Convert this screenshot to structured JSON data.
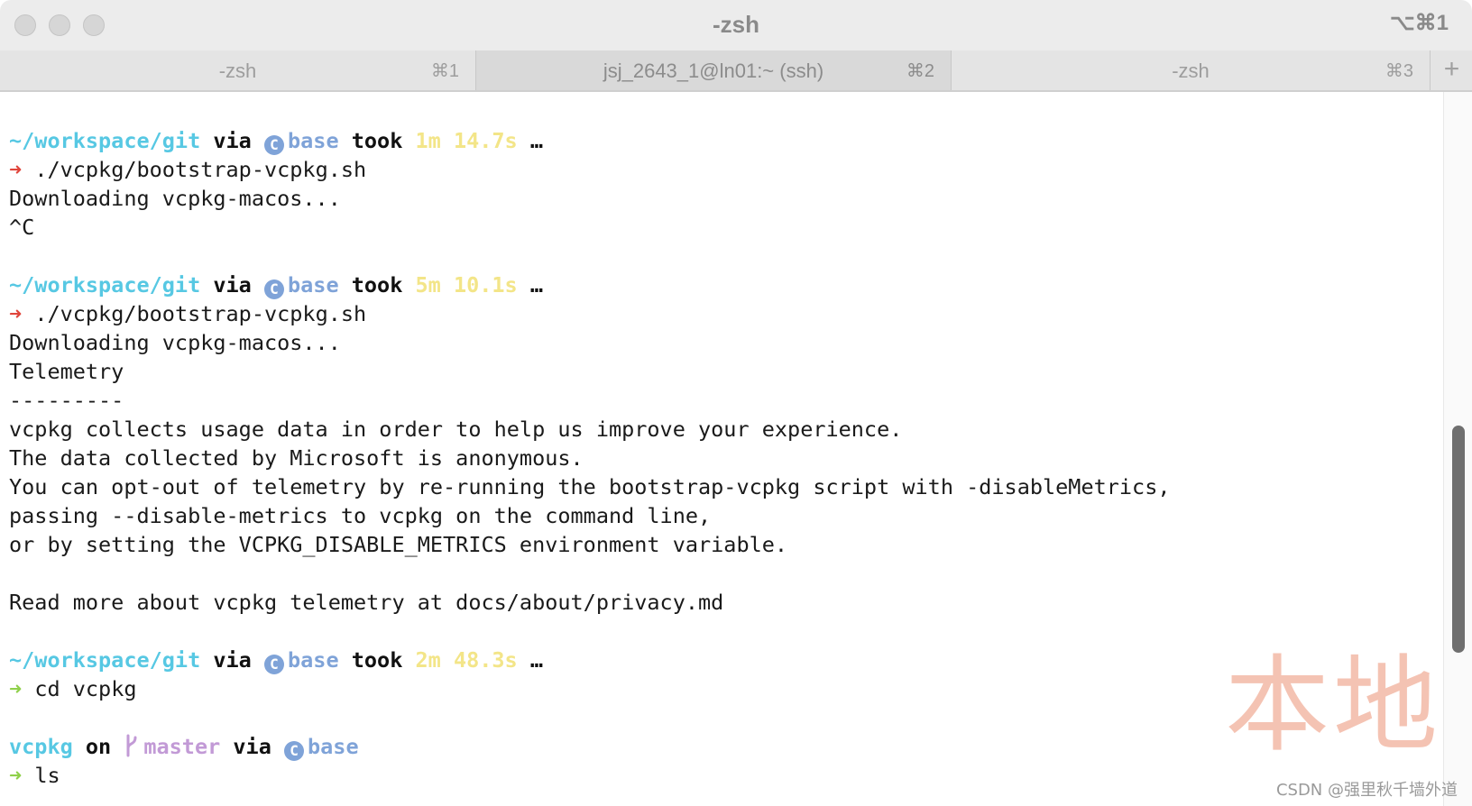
{
  "window": {
    "title": "-zsh",
    "shortcut": "⌥⌘1"
  },
  "tabs": [
    {
      "label": "-zsh",
      "key": "⌘1"
    },
    {
      "label": "jsj_2643_1@ln01:~ (ssh)",
      "key": "⌘2"
    },
    {
      "label": "-zsh",
      "key": "⌘3"
    }
  ],
  "new_tab": "+",
  "terminal": {
    "block1": {
      "path": "~/workspace/git",
      "via": "via",
      "env": "base",
      "took": "took",
      "duration": "1m 14.7s",
      "ellipsis": "…",
      "arrow": "➜",
      "command": "./vcpkg/bootstrap-vcpkg.sh",
      "out1": "Downloading vcpkg-macos...",
      "out2": "^C"
    },
    "block2": {
      "path": "~/workspace/git",
      "via": "via",
      "env": "base",
      "took": "took",
      "duration": "5m 10.1s",
      "ellipsis": "…",
      "arrow": "➜",
      "command": "./vcpkg/bootstrap-vcpkg.sh",
      "out1": "Downloading vcpkg-macos...",
      "out2": "Telemetry",
      "out3": "---------",
      "out4": "vcpkg collects usage data in order to help us improve your experience.",
      "out5": "The data collected by Microsoft is anonymous.",
      "out6": "You can opt-out of telemetry by re-running the bootstrap-vcpkg script with -disableMetrics,",
      "out7": "passing --disable-metrics to vcpkg on the command line,",
      "out8": "or by setting the VCPKG_DISABLE_METRICS environment variable.",
      "out9": "Read more about vcpkg telemetry at docs/about/privacy.md"
    },
    "block3": {
      "path": "~/workspace/git",
      "via": "via",
      "env": "base",
      "took": "took",
      "duration": "2m 48.3s",
      "ellipsis": "…",
      "arrow": "➜",
      "command": "cd vcpkg"
    },
    "block4": {
      "dir": "vcpkg",
      "on": "on",
      "branch": "master",
      "via": "via",
      "env": "base",
      "arrow": "➜",
      "command": "ls"
    },
    "conda_icon": "C"
  },
  "watermark": {
    "big": "本地",
    "small": "CSDN @强里秋千墙外道"
  }
}
